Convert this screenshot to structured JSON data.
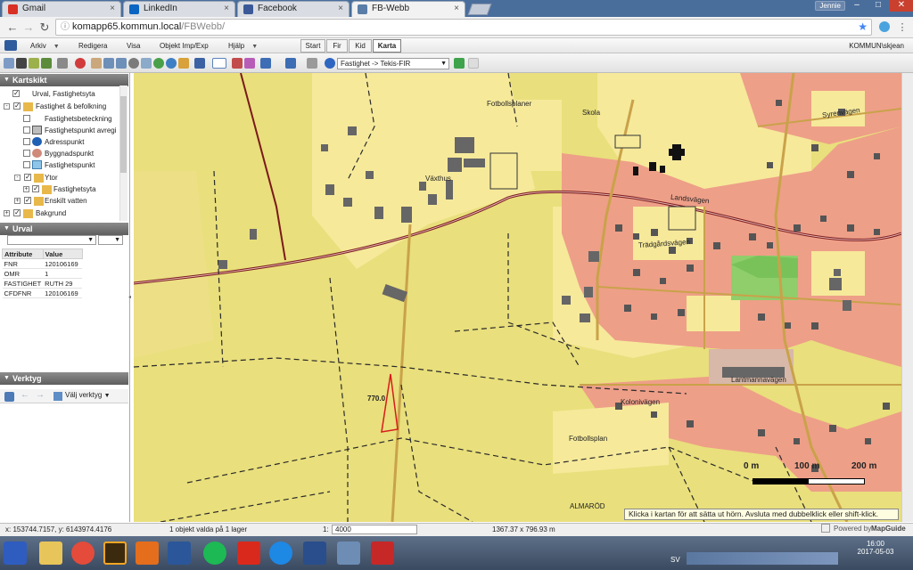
{
  "browser": {
    "tabs": [
      {
        "label": "Gmail",
        "color": "#d93025"
      },
      {
        "label": "LinkedIn",
        "color": "#0a66c2"
      },
      {
        "label": "Facebook",
        "color": "#3b5998"
      },
      {
        "label": "FB-Webb",
        "color": "#5a7ea8"
      }
    ],
    "tab_close": "×",
    "window_user": "Jennie",
    "url_domain": "komapp65.kommun.local",
    "url_path": "/FBWebb/"
  },
  "app": {
    "menu": [
      "Arkiv",
      "Redigera",
      "Visa",
      "Objekt Imp/Exp",
      "Hjälp"
    ],
    "mode_tabs": [
      "Start",
      "Fir",
      "Kid",
      "Karta"
    ],
    "active_mode": "Karta",
    "user": "KOMMUN\\skjean",
    "toolbar_select": "Fastighet -> Tekis-FIR"
  },
  "left_panel": {
    "kartskikt_title": "Kartskikt",
    "layers": [
      {
        "label": "Urval, Fastighetsyta",
        "checked": true
      },
      {
        "label": "Fastighet & befolkning",
        "checked": true
      },
      {
        "label": "Fastighetsbeteckning",
        "checked": false
      },
      {
        "label": "Fastighetspunkt avregi",
        "checked": false
      },
      {
        "label": "Adresspunkt",
        "checked": false
      },
      {
        "label": "Byggnadspunkt",
        "checked": false
      },
      {
        "label": "Fastighetspunkt",
        "checked": false
      },
      {
        "label": "Ytor",
        "checked": true
      },
      {
        "label": "Fastighetsyta",
        "checked": true
      },
      {
        "label": "Enskilt vatten",
        "checked": true
      },
      {
        "label": "Bakgrund",
        "checked": true
      }
    ],
    "urval_title": "Urval",
    "attr_headers": [
      "Attribute",
      "Value"
    ],
    "attributes": [
      [
        "FNR",
        "120106169"
      ],
      [
        "OMR",
        "1"
      ],
      [
        "FASTIGHET",
        "RUTH 29"
      ],
      [
        "CFDFNR",
        "120106169"
      ]
    ],
    "verktyg_title": "Verktyg",
    "verktyg_select": "Välj verktyg"
  },
  "map": {
    "labels": {
      "fotbollsplaner": "Fotbollsplaner",
      "skola": "Skola",
      "vaxthus": "Växthus",
      "landsvagen": "Landsvägen",
      "tradgardsvagen": "Trädgårdsvägen",
      "syrenvagen": "Syrenvägen",
      "kolonivagen": "Kolonivägen",
      "lantmannavagen": "Lantmannavägen",
      "fotbollsplan": "Fotbollsplan",
      "almarod": "ALMARÖD",
      "dim": "770.0"
    },
    "scale": {
      "l0": "0 m",
      "l1": "100 m",
      "l2": "200 m"
    },
    "tooltip": "Klicka i kartan för att sätta ut hörn. Avsluta med dubbelklick eller shift-klick."
  },
  "status": {
    "coords": "x: 153744.7157, y: 6143974.4176",
    "selection": "1 objekt valda på 1 lager",
    "scale_prefix": "1:",
    "scale": "4000",
    "size": "1367.37 x 796.93 m",
    "powered": "Powered by",
    "mapguide": "MapGuide"
  },
  "taskbar": {
    "lang": "SV",
    "time": "16:00",
    "date": "2017-05-03"
  }
}
